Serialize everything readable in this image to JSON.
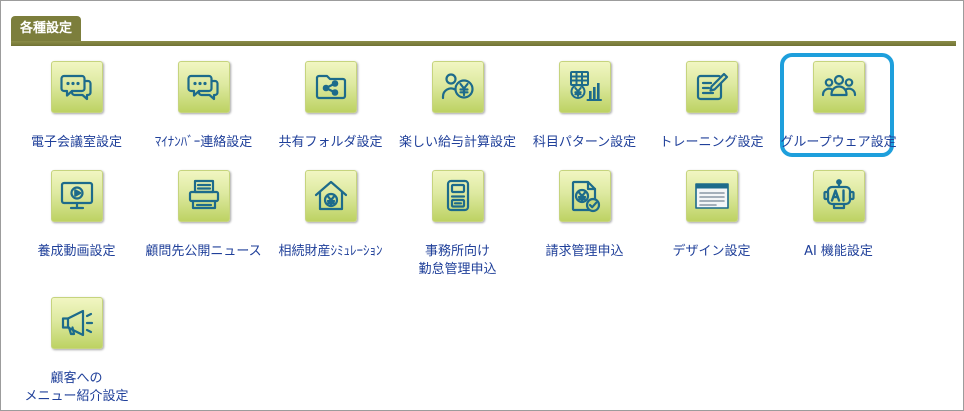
{
  "tab": {
    "label": "各種設定"
  },
  "colors": {
    "tab_bg": "#7c7e3c",
    "tab_text": "#ffffff",
    "label_text": "#20409a",
    "icon": "#1d6b8b",
    "highlight": "#1e9fdc",
    "tile_top": "#f1f6c2",
    "tile_bottom": "#bdd263"
  },
  "items": [
    {
      "icon": "chat-bubbles-icon",
      "label": [
        "電子会議室設定"
      ]
    },
    {
      "icon": "chat-bubbles-icon",
      "label": [
        "ﾏｲﾅﾝﾊﾞｰ連絡設定"
      ]
    },
    {
      "icon": "shared-folder-icon",
      "label": [
        "共有フォルダ設定"
      ]
    },
    {
      "icon": "person-yen-icon",
      "label": [
        "楽しい給与計算設定"
      ]
    },
    {
      "icon": "spreadsheet-chart-icon",
      "label": [
        "科目パターン設定"
      ]
    },
    {
      "icon": "notepad-pen-icon",
      "label": [
        "トレーニング設定"
      ]
    },
    {
      "icon": "group-icon",
      "label": [
        "グループウェア設定"
      ],
      "highlighted": true
    },
    {
      "icon": "monitor-play-icon",
      "label": [
        "養成動画設定"
      ]
    },
    {
      "icon": "printer-icon",
      "label": [
        "顧問先公開ニュース"
      ]
    },
    {
      "icon": "house-yen-icon",
      "label": [
        "相続財産ｼﾐｭﾚｰｼｮﾝ"
      ]
    },
    {
      "icon": "timecard-device-icon",
      "label": [
        "事務所向け",
        "勤怠管理申込"
      ]
    },
    {
      "icon": "invoice-check-icon",
      "label": [
        "請求管理申込"
      ]
    },
    {
      "icon": "window-layout-icon",
      "label": [
        "デザイン設定"
      ]
    },
    {
      "icon": "ai-robot-icon",
      "label": [
        "AI 機能設定"
      ]
    },
    {
      "icon": "megaphone-icon",
      "label": [
        "顧客への",
        "メニュー紹介設定"
      ]
    }
  ]
}
